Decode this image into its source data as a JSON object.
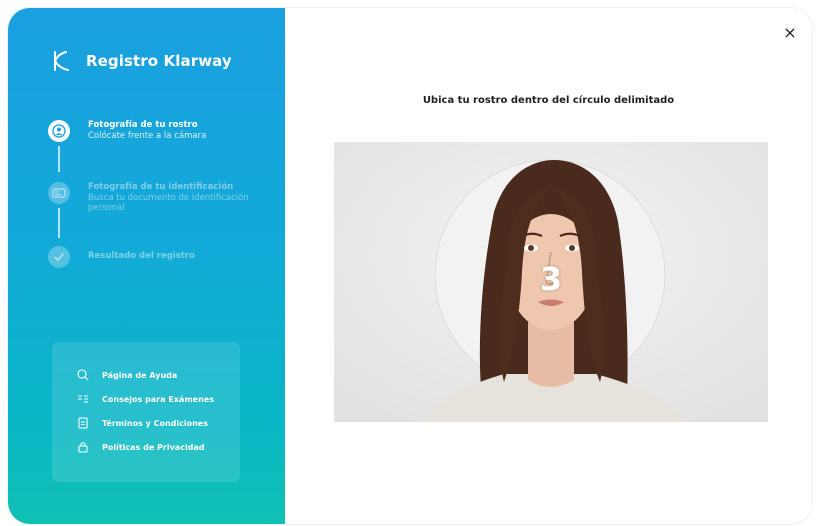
{
  "brand": {
    "title": "Registro Klarway"
  },
  "steps": [
    {
      "title": "Fotografía de tu rostro",
      "subtitle": "Colócate frente a la cámara",
      "state": "active"
    },
    {
      "title": "Fotografía de tu identificación",
      "subtitle": "Busca tu documento de identificación personal",
      "state": "inactive"
    },
    {
      "title": "Resultado del registro",
      "subtitle": "",
      "state": "inactive"
    }
  ],
  "help_links": [
    {
      "label": "Página de Ayuda",
      "icon": "chat-icon"
    },
    {
      "label": "Consejos para Exámenes",
      "icon": "tips-icon"
    },
    {
      "label": "Términos y Condiciones",
      "icon": "document-icon"
    },
    {
      "label": "Políticas de Privacidad",
      "icon": "lock-icon"
    }
  ],
  "main": {
    "instruction": "Ubica tu rostro dentro del círculo delimitado",
    "countdown": "3",
    "close_label": "×"
  },
  "colors": {
    "sidebar_top": "#1a9fe0",
    "sidebar_bottom": "#10c0b4",
    "accent": "#1a9fe0"
  }
}
